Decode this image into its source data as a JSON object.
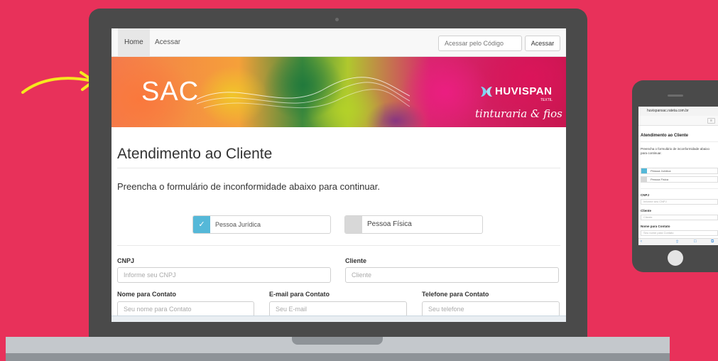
{
  "nav": {
    "home": "Home",
    "acessar_link": "Acessar",
    "code_placeholder": "Acessar pelo Código",
    "acessar_button": "Acessar"
  },
  "banner": {
    "sac": "SAC",
    "brand": "HUVISPAN",
    "brand_sub": "TEXTIL",
    "tagline": "tinturaria & fios"
  },
  "form": {
    "title": "Atendimento ao Cliente",
    "subtitle": "Preencha o formulário de inconformidade abaixo para continuar.",
    "type_pj": "Pessoa Jurídica",
    "type_pf": "Pessoa Física",
    "check": "✓",
    "cnpj_label": "CNPJ",
    "cnpj_placeholder": "Informe seu CNPJ",
    "cliente_label": "Cliente",
    "cliente_placeholder": "Cliente",
    "nome_label": "Nome para Contato",
    "nome_placeholder": "Seu nome para Contato",
    "email_label": "E-mail para Contato",
    "email_placeholder": "Seu E-mail",
    "telefone_label": "Telefone para Contato",
    "telefone_placeholder": "Seu telefone"
  },
  "phone": {
    "url": "huvispansac.rateta.com.br",
    "title": "Atendimento ao Cliente",
    "subtitle": "Preencha o formulário de inconformidade abaixo para continuar.",
    "type_pj": "Pessoa Jurídica",
    "type_pf": "Pessoa Física",
    "cnpj_label": "CNPJ",
    "cnpj_placeholder": "Informe seu CNPJ",
    "cliente_label": "Cliente",
    "cliente_placeholder": "Cliente",
    "nome_label": "Nome para Contato",
    "nome_placeholder": "Seu nome para Contato"
  },
  "colors": {
    "background": "#e8315a",
    "accent_check": "#55b8d8",
    "device": "#4a4a4a",
    "arrow": "#f6e81e"
  }
}
